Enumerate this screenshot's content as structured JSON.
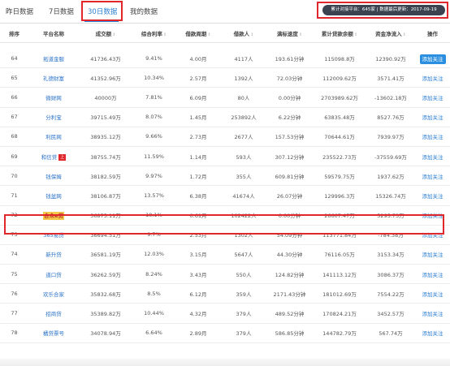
{
  "tabs": [
    {
      "label": "昨日数据"
    },
    {
      "label": "7日数据"
    },
    {
      "label": "30日数据"
    },
    {
      "label": "我的数据"
    }
  ],
  "info": {
    "platforms": "累计对接平台：645家",
    "updated": "数据最后更新：2017-09-19"
  },
  "table": {
    "headers": [
      "排序",
      "平台名称",
      "成交额",
      "综合利率",
      "借款周期",
      "借款人",
      "满标速度",
      "累计贷款余额",
      "资金净流入",
      "操作"
    ],
    "sort_icon": "↕",
    "rows": [
      {
        "rank": "64",
        "name": "拓道金服",
        "volume": "41736.43万",
        "rate": "9.41%",
        "period": "4.00月",
        "borrowers": "4117人",
        "speed": "193.61分钟",
        "balance": "115098.8万",
        "inflow": "12390.92万",
        "action": "添加关注"
      },
      {
        "rank": "65",
        "name": "礼德财富",
        "volume": "41352.96万",
        "rate": "10.34%",
        "period": "2.57月",
        "borrowers": "1392人",
        "speed": "72.03分钟",
        "balance": "112009.62万",
        "inflow": "3571.41万",
        "action": "添加关注"
      },
      {
        "rank": "66",
        "name": "微财网",
        "volume": "40000万",
        "rate": "7.81%",
        "period": "6.09月",
        "borrowers": "80人",
        "speed": "0.00分钟",
        "balance": "2703989.62万",
        "inflow": "-13602.18万",
        "action": "添加关注"
      },
      {
        "rank": "67",
        "name": "分利宝",
        "volume": "39715.49万",
        "rate": "8.07%",
        "period": "1.45月",
        "borrowers": "253892人",
        "speed": "6.22分钟",
        "balance": "63835.48万",
        "inflow": "8527.76万",
        "action": "添加关注"
      },
      {
        "rank": "68",
        "name": "利民网",
        "volume": "38935.12万",
        "rate": "9.66%",
        "period": "2.73月",
        "borrowers": "2677人",
        "speed": "157.53分钟",
        "balance": "70644.61万",
        "inflow": "7939.97万",
        "action": "添加关注"
      },
      {
        "rank": "69",
        "name": "和信贷",
        "badge": "上",
        "volume": "38755.74万",
        "rate": "11.59%",
        "period": "1.14月",
        "borrowers": "593人",
        "speed": "307.12分钟",
        "balance": "235522.73万",
        "inflow": "-37559.69万",
        "action": "添加关注"
      },
      {
        "rank": "70",
        "name": "钱保姆",
        "volume": "38182.59万",
        "rate": "9.97%",
        "period": "1.72月",
        "borrowers": "355人",
        "speed": "609.81分钟",
        "balance": "59579.75万",
        "inflow": "1937.62万",
        "action": "添加关注"
      },
      {
        "rank": "71",
        "name": "钱盆网",
        "volume": "38106.87万",
        "rate": "13.57%",
        "period": "6.38月",
        "borrowers": "41674人",
        "speed": "26.07分钟",
        "balance": "129996.3万",
        "inflow": "15326.74万",
        "action": "添加关注"
      },
      {
        "rank": "72",
        "name": "合众e贷",
        "volume": "36875.11万",
        "rate": "10.1%",
        "period": "0.61月",
        "borrowers": "102422人",
        "speed": "0.00分钟",
        "balance": "26607.47万",
        "inflow": "5295.73万",
        "action": "添加关注"
      },
      {
        "rank": "73",
        "name": "365易贷",
        "volume": "36694.51万",
        "rate": "9.7%",
        "period": "2.53月",
        "borrowers": "1302人",
        "speed": "54.09分钟",
        "balance": "113771.84万",
        "inflow": "-784.38万",
        "action": "添加关注"
      },
      {
        "rank": "74",
        "name": "新升贷",
        "volume": "36581.19万",
        "rate": "12.03%",
        "period": "3.15月",
        "borrowers": "5647人",
        "speed": "44.30分钟",
        "balance": "76116.05万",
        "inflow": "3153.34万",
        "action": "添加关注"
      },
      {
        "rank": "75",
        "name": "道口贷",
        "volume": "36262.59万",
        "rate": "8.24%",
        "period": "3.43月",
        "borrowers": "550人",
        "speed": "124.82分钟",
        "balance": "141113.12万",
        "inflow": "3086.37万",
        "action": "添加关注"
      },
      {
        "rank": "76",
        "name": "欢乐合家",
        "volume": "35832.68万",
        "rate": "8.5%",
        "period": "6.12月",
        "borrowers": "359人",
        "speed": "2171.43分钟",
        "balance": "181012.69万",
        "inflow": "7554.22万",
        "action": "添加关注"
      },
      {
        "rank": "77",
        "name": "招商贷",
        "volume": "35389.82万",
        "rate": "10.44%",
        "period": "4.32月",
        "borrowers": "379人",
        "speed": "489.52分钟",
        "balance": "170824.21万",
        "inflow": "3452.57万",
        "action": "添加关注"
      },
      {
        "rank": "78",
        "name": "橘贷票号",
        "volume": "34078.94万",
        "rate": "6.64%",
        "period": "2.89月",
        "borrowers": "379人",
        "speed": "586.85分钟",
        "balance": "144782.79万",
        "inflow": "567.74万",
        "action": "添加关注"
      }
    ]
  }
}
